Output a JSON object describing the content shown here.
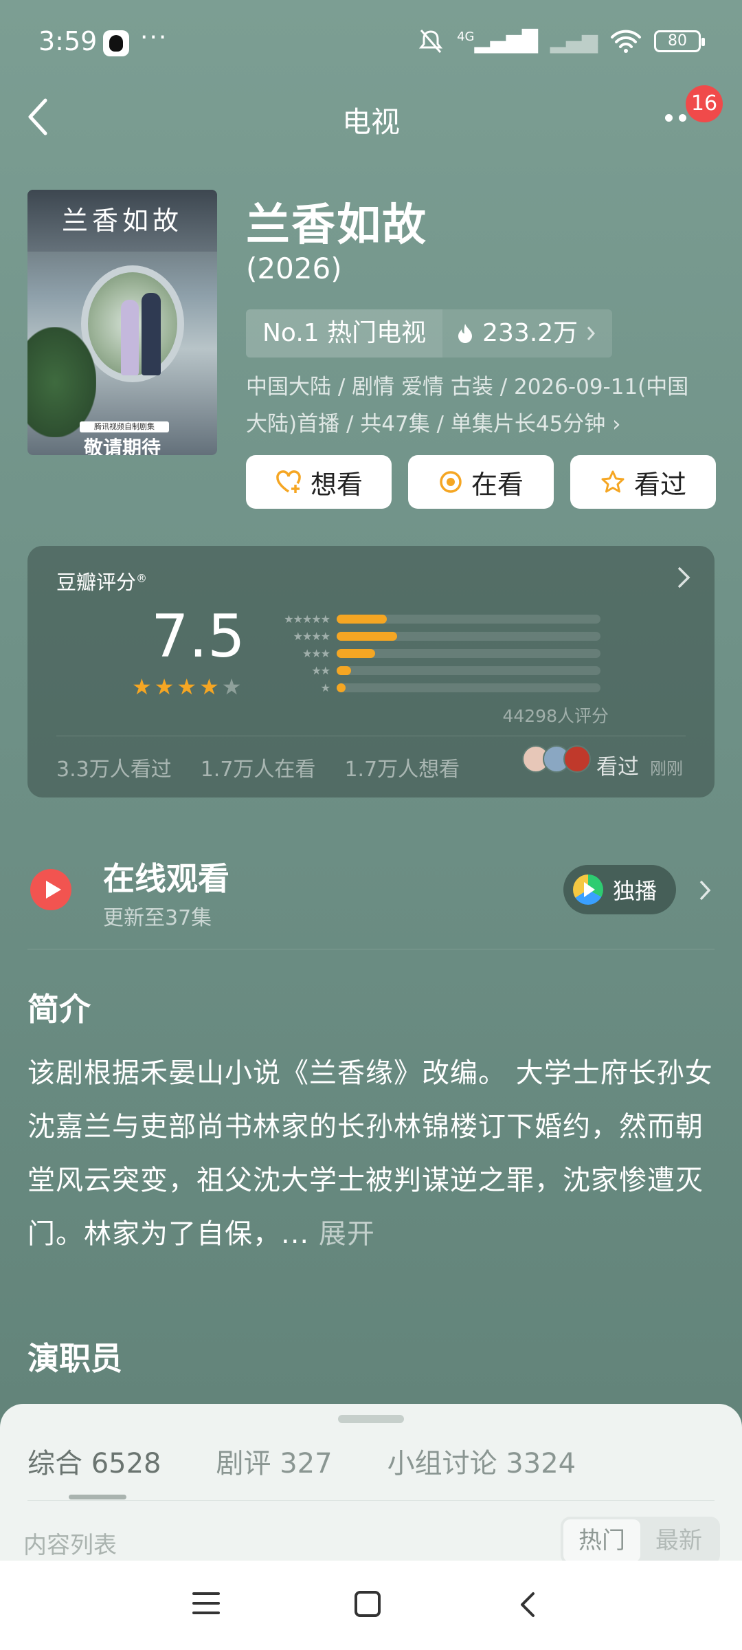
{
  "status_bar": {
    "time": "3:59",
    "dots": "···",
    "network": "4G",
    "battery": "80"
  },
  "nav": {
    "title": "电视",
    "badge": "16"
  },
  "poster": {
    "title": "兰香如故",
    "tag": "腾讯视频自制剧集",
    "subtitle": "敬请期待"
  },
  "show": {
    "title": "兰香如故",
    "year": "(2026)",
    "rank_label": "No.1 热门电视",
    "heat": "233.2万",
    "meta_line1": "中国大陆 / 剧情 爱情 古装 / 2026-09-11(中国",
    "meta_line2": "大陆)首播 / 共47集 / 单集片长45分钟"
  },
  "actions": {
    "want": "想看",
    "watching": "在看",
    "watched": "看过"
  },
  "rating": {
    "label": "豆瓣评分",
    "registered": "®",
    "score": "7.5",
    "stars": 3.75,
    "distribution": [
      0.19,
      0.23,
      0.145,
      0.055,
      0.035
    ],
    "distribution_stars": [
      "★★★★★",
      "★★★★",
      "★★★",
      "★★",
      "★"
    ],
    "count": "44298人评分",
    "watched": "3.3万人看过",
    "watching": "1.7万人在看",
    "want": "1.7万人想看",
    "friend_action": "看过",
    "friend_time": "刚刚"
  },
  "online": {
    "title": "在线观看",
    "subtitle": "更新至37集",
    "exclusive": "独播"
  },
  "synopsis": {
    "title": "简介",
    "text": "该剧根据禾晏山小说《兰香缘》改编。 大学士府长孙女沈嘉兰与吏部尚书林家的长孙林锦楼订下婚约，然而朝堂风云突变，祖父沈大学士被判谋逆之罪，沈家惨遭灭门。林家为了自保，... ",
    "expand": "展开"
  },
  "cast": {
    "title": "演职员"
  },
  "sheet": {
    "tabs": [
      "综合 6528",
      "剧评 327",
      "小组讨论 3324"
    ],
    "list_label": "内容列表",
    "sort_hot": "热门",
    "sort_new": "最新"
  },
  "colors": {
    "accent_star": "#f5a623",
    "play_red": "#f25450",
    "badge_red": "#f04a4a"
  }
}
